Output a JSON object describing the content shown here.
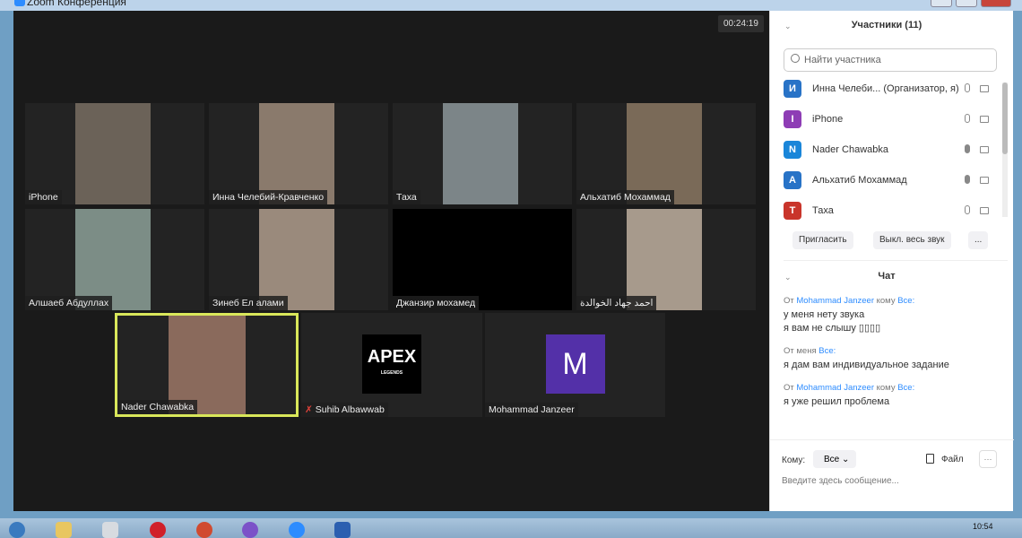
{
  "window": {
    "title": "Zoom Конференция"
  },
  "meeting": {
    "timer": "00:24:19"
  },
  "tiles": [
    {
      "name": "iPhone",
      "feed": "#6b6258"
    },
    {
      "name": "Инна Челебий-Кравченко",
      "feed": "#8a7a6c"
    },
    {
      "name": "Таха",
      "feed": "#7c8588"
    },
    {
      "name": "Альхатиб Мохаммад",
      "feed": "#7a6a58"
    },
    {
      "name": "Алшаеб Абдуллах",
      "feed": "#7c8d86"
    },
    {
      "name": "Зинеб Ел алами",
      "feed": "#9a8a7c"
    },
    {
      "name": "Джанзир мохамед",
      "feed": "#000000"
    },
    {
      "name": "احمد جهاد الخوالدة",
      "feed": "#a79a8c"
    },
    {
      "name": "Nader Chawabka",
      "feed": "#8a6a5c",
      "active": true
    },
    {
      "name": "Suhib Albawwab",
      "logo": "APEX",
      "logo_sub": "LEGENDS",
      "muted": true
    },
    {
      "name": "Mohammad Janzeer",
      "initial": "M",
      "color": "#5330a8"
    }
  ],
  "participants": {
    "title": "Участники (11)",
    "search_placeholder": "Найти участника",
    "list": [
      {
        "initial": "И",
        "name": "Инна Челеби...  (Организатор, я)",
        "color": "#2873c7",
        "mic_on": false
      },
      {
        "initial": "I",
        "name": "iPhone",
        "color": "#8e3db5",
        "mic_on": false
      },
      {
        "initial": "N",
        "name": "Nader Chawabka",
        "color": "#1a86d9",
        "mic_on": true
      },
      {
        "initial": "A",
        "name": "Альхатиб Мохаммад",
        "color": "#2873c7",
        "mic_on": true
      },
      {
        "initial": "T",
        "name": "Таха",
        "color": "#c9352b",
        "mic_on": false
      }
    ],
    "invite": "Пригласить",
    "mute_all": "Выкл. весь звук",
    "more": "..."
  },
  "chat": {
    "title": "Чат",
    "messages": [
      {
        "from_prefix": "От",
        "from": "Mohammad Janzeer",
        "to_prefix": "кому",
        "to": "Все:",
        "lines": [
          "у меня нету звука",
          "я вам не слышу ▯▯▯▯"
        ]
      },
      {
        "from_prefix": "От меня",
        "from": "",
        "to_prefix": "",
        "to": "Все:",
        "lines": [
          "я дам вам индивидуальное задание"
        ]
      },
      {
        "from_prefix": "От",
        "from": "Mohammad Janzeer",
        "to_prefix": "кому",
        "to": "Все:",
        "lines": [
          "я уже решил проблема"
        ]
      }
    ],
    "to_label": "Кому:",
    "to_value": "Все",
    "file": "Файл",
    "more": "···",
    "input_placeholder": "Введите здесь сообщение..."
  },
  "taskbar": {
    "clock": "10:54"
  }
}
